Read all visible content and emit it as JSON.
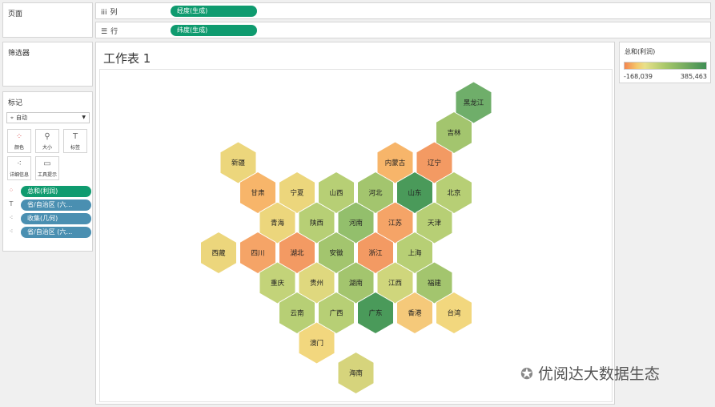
{
  "pages_panel": {
    "title": "页面"
  },
  "filters_panel": {
    "title": "筛选器"
  },
  "marks_panel": {
    "title": "标记",
    "mark_type": "自动",
    "cards": [
      {
        "label": "颜色",
        "icon": "color-dots-icon"
      },
      {
        "label": "大小",
        "icon": "size-icon"
      },
      {
        "label": "标签",
        "icon": "label-icon"
      },
      {
        "label": "详细信息",
        "icon": "detail-icon"
      },
      {
        "label": "工具提示",
        "icon": "tooltip-icon"
      }
    ],
    "fields": [
      {
        "label": "总和(利润)",
        "icon": "color-dots-icon",
        "style": "green"
      },
      {
        "label": "省/自治区 (六…",
        "icon": "label-icon",
        "style": "blue"
      },
      {
        "label": "收集(几何)",
        "icon": "detail-icon",
        "style": "blue"
      },
      {
        "label": "省/自治区 (六…",
        "icon": "detail-icon",
        "style": "blue"
      }
    ]
  },
  "columns_shelf": {
    "label": "列",
    "pill": "经度(生成)"
  },
  "rows_shelf": {
    "label": "行",
    "pill": "纬度(生成)"
  },
  "sheet": {
    "title": "工作表 1"
  },
  "legend": {
    "title": "总和(利润)",
    "min_label": "-168,039",
    "max_label": "385,463"
  },
  "colors": {
    "accent_green": "#0f9b6f",
    "pill_blue": "#4a8fb1"
  },
  "hexmap": {
    "cells": [
      {
        "name": "黑龙江",
        "col": 13,
        "row": 0,
        "color": "#6fae6a"
      },
      {
        "name": "吉林",
        "col": 12,
        "row": 1,
        "color": "#a3c56e"
      },
      {
        "name": "新疆",
        "col": 1,
        "row": 2,
        "color": "#ecd67c"
      },
      {
        "name": "内蒙古",
        "col": 9,
        "row": 2,
        "color": "#f7b56a"
      },
      {
        "name": "辽宁",
        "col": 11,
        "row": 2,
        "color": "#f39a63"
      },
      {
        "name": "甘肃",
        "col": 2,
        "row": 3,
        "color": "#f7b56a"
      },
      {
        "name": "宁夏",
        "col": 4,
        "row": 3,
        "color": "#ecd67c"
      },
      {
        "name": "山西",
        "col": 6,
        "row": 3,
        "color": "#b7cf75"
      },
      {
        "name": "河北",
        "col": 8,
        "row": 3,
        "color": "#a3c56e"
      },
      {
        "name": "山东",
        "col": 10,
        "row": 3,
        "color": "#4a9a5a"
      },
      {
        "name": "北京",
        "col": 12,
        "row": 3,
        "color": "#b7cf75"
      },
      {
        "name": "青海",
        "col": 3,
        "row": 4,
        "color": "#ecd67c"
      },
      {
        "name": "陕西",
        "col": 5,
        "row": 4,
        "color": "#b7cf75"
      },
      {
        "name": "河南",
        "col": 7,
        "row": 4,
        "color": "#93bf6c"
      },
      {
        "name": "江苏",
        "col": 9,
        "row": 4,
        "color": "#f5a467"
      },
      {
        "name": "天津",
        "col": 11,
        "row": 4,
        "color": "#b7cf75"
      },
      {
        "name": "西藏",
        "col": 0,
        "row": 5,
        "color": "#ecd67c"
      },
      {
        "name": "四川",
        "col": 2,
        "row": 5,
        "color": "#f5a467"
      },
      {
        "name": "湖北",
        "col": 4,
        "row": 5,
        "color": "#f39a63"
      },
      {
        "name": "安徽",
        "col": 6,
        "row": 5,
        "color": "#a3c56e"
      },
      {
        "name": "浙江",
        "col": 8,
        "row": 5,
        "color": "#f39a63"
      },
      {
        "name": "上海",
        "col": 10,
        "row": 5,
        "color": "#b7cf75"
      },
      {
        "name": "重庆",
        "col": 3,
        "row": 6,
        "color": "#c3d379"
      },
      {
        "name": "贵州",
        "col": 5,
        "row": 6,
        "color": "#dfd87e"
      },
      {
        "name": "湖南",
        "col": 7,
        "row": 6,
        "color": "#a3c56e"
      },
      {
        "name": "江西",
        "col": 9,
        "row": 6,
        "color": "#cfd67c"
      },
      {
        "name": "福建",
        "col": 11,
        "row": 6,
        "color": "#a3c56e"
      },
      {
        "name": "云南",
        "col": 4,
        "row": 7,
        "color": "#b7cf75"
      },
      {
        "name": "广西",
        "col": 6,
        "row": 7,
        "color": "#b7cf75"
      },
      {
        "name": "广东",
        "col": 8,
        "row": 7,
        "color": "#4a9a5a"
      },
      {
        "name": "香港",
        "col": 10,
        "row": 7,
        "color": "#f5c97a"
      },
      {
        "name": "台湾",
        "col": 12,
        "row": 7,
        "color": "#f2d77e"
      },
      {
        "name": "澳门",
        "col": 5,
        "row": 8,
        "color": "#f2d77e"
      },
      {
        "name": "海南",
        "col": 7,
        "row": 9,
        "color": "#d6d47c"
      }
    ]
  },
  "watermark": {
    "text": "优阅达大数据生态",
    "icon": "wechat-icon"
  }
}
